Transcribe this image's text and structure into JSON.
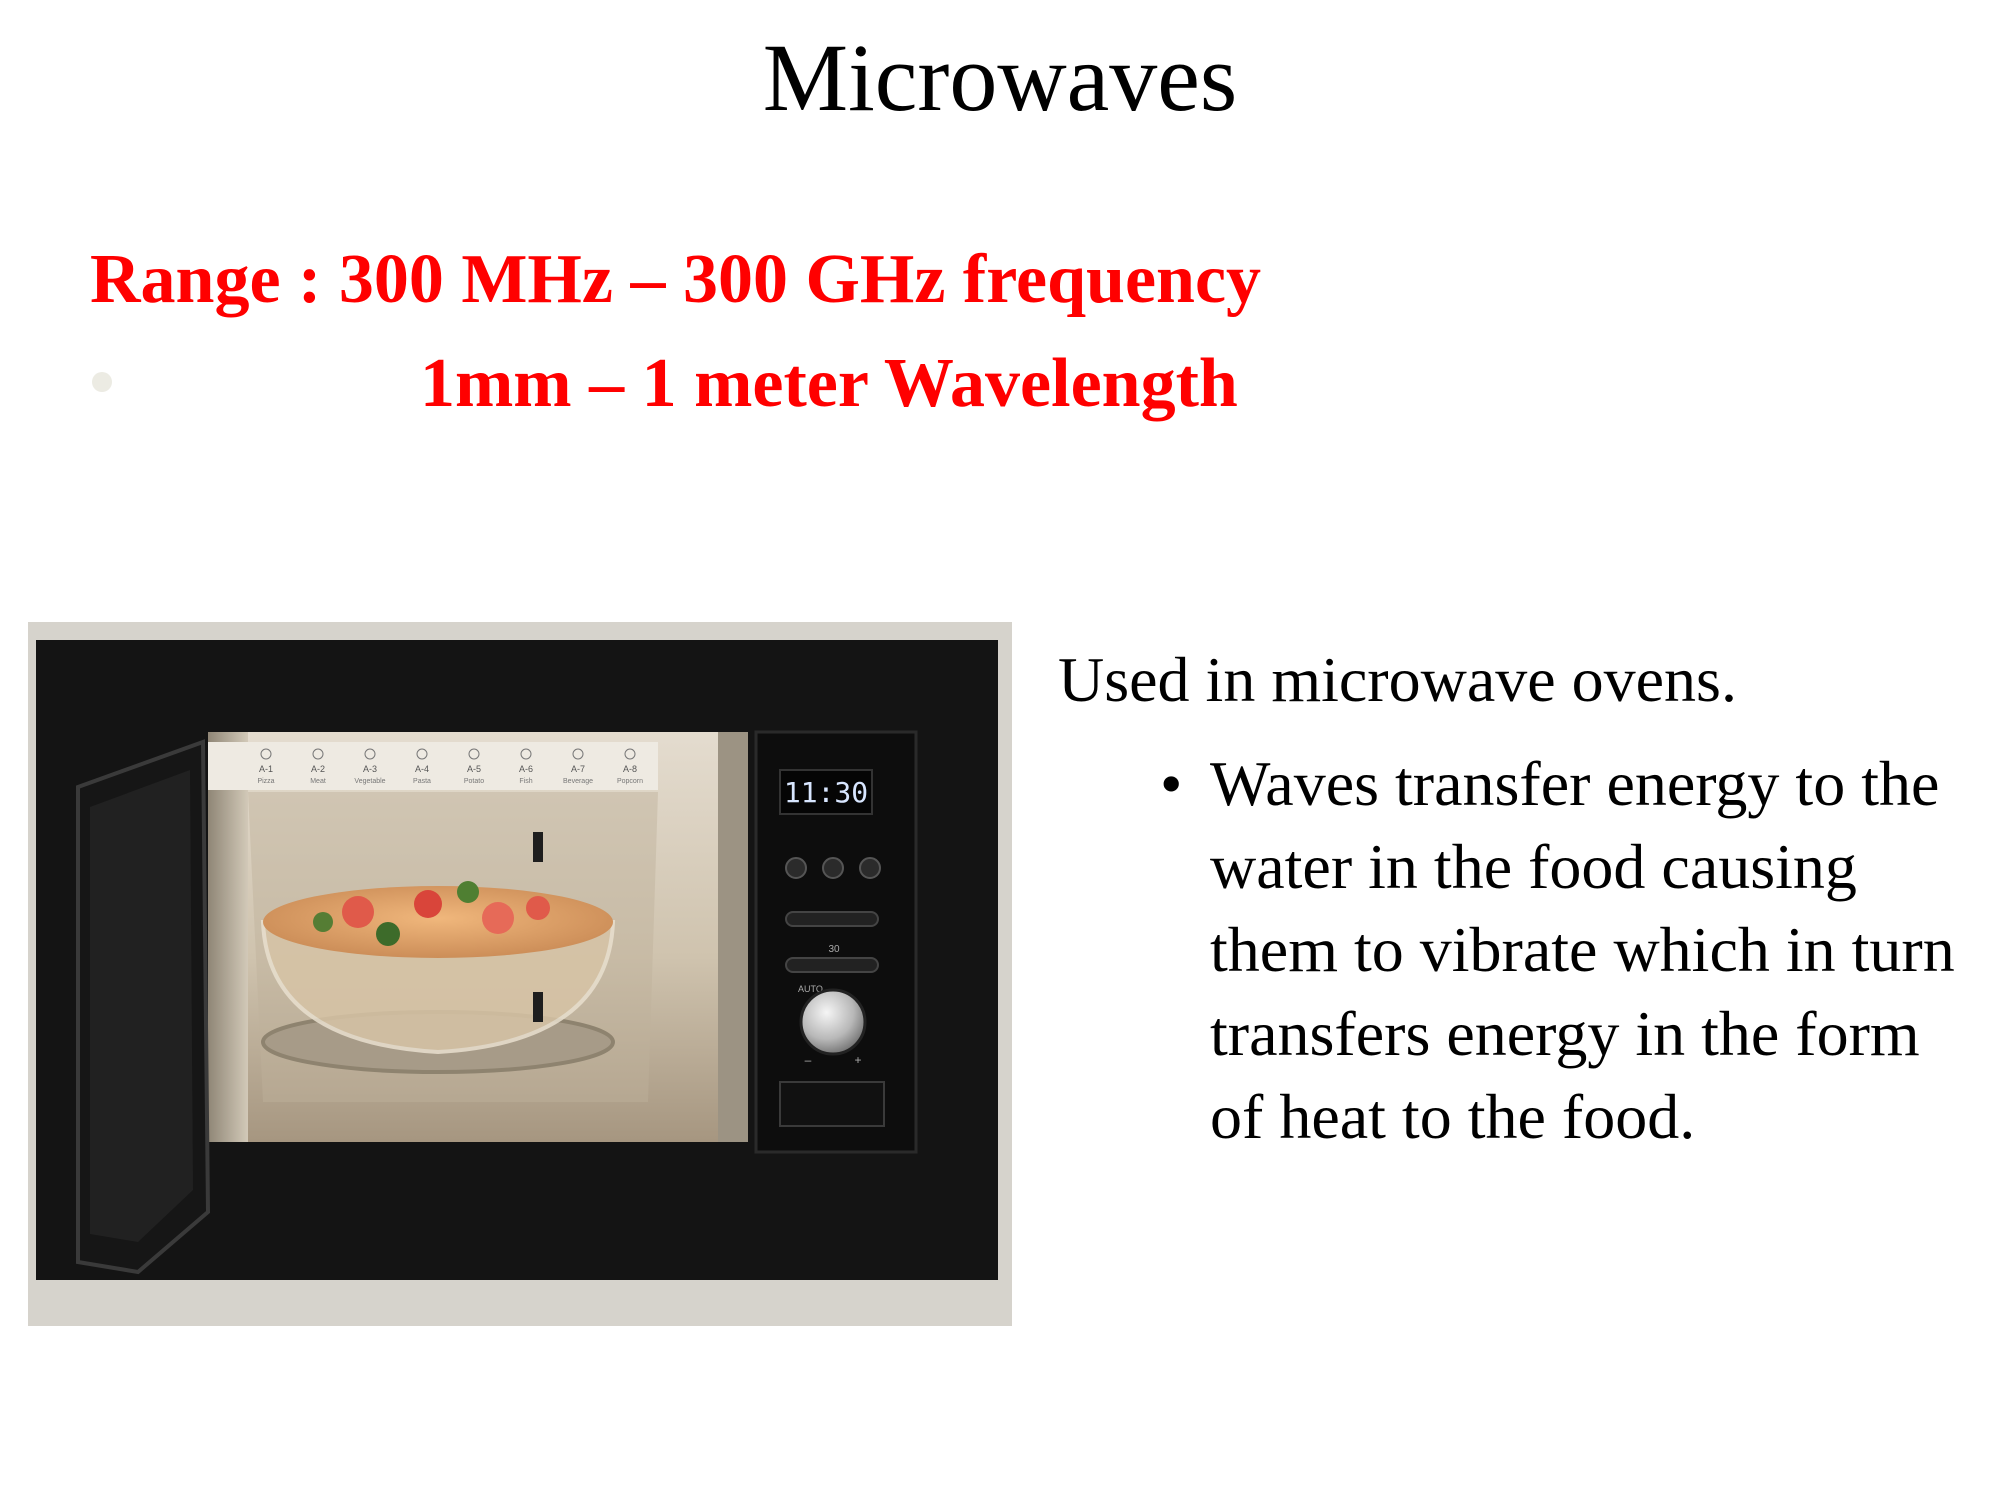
{
  "slide": {
    "title": "Microwaves",
    "range_line": "Range : 300 MHz – 300 GHz frequency",
    "wavelength_line": "1mm – 1 meter Wavelength",
    "usage": "Used in microwave ovens.",
    "detail_bullet": "•",
    "detail": "Waves transfer energy to the water in the food causing them to vibrate which in turn transfers energy in the form of heat to the food."
  },
  "oven": {
    "display_time": "11:30",
    "program_codes": [
      "A-1",
      "A-2",
      "A-3",
      "A-4",
      "A-5",
      "A-6",
      "A-7",
      "A-8"
    ],
    "program_names": [
      "Pizza",
      "Meat",
      "Vegetable",
      "Pasta",
      "Potato",
      "Fish",
      "Beverage",
      "Popcorn"
    ],
    "auto_label": "AUTO",
    "minus_label": "–",
    "plus_label": "+",
    "start_label": "30"
  },
  "colors": {
    "title": "#000000",
    "highlight": "#ff0000",
    "body_text": "#000000",
    "oven_frame": "#141414",
    "display_digits": "#d8e6ff"
  }
}
